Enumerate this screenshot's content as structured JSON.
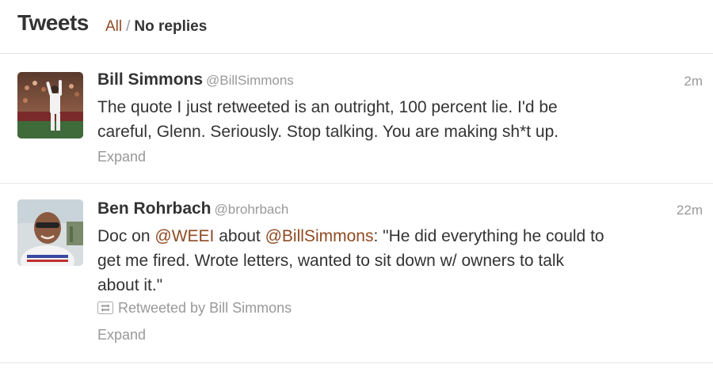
{
  "header": {
    "title": "Tweets",
    "filter_all": "All",
    "filter_separator": "/",
    "filter_no_replies": "No replies"
  },
  "colors": {
    "link": "#8f4a22",
    "muted": "#999999",
    "text": "#333333",
    "divider": "#e3e3e3"
  },
  "tweets": [
    {
      "fullname": "Bill Simmons",
      "username": "@BillSimmons",
      "time": "2m",
      "text_line1": "The quote I just retweeted is an outright, 100 percent lie. I'd be",
      "text_line2": "careful, Glenn. Seriously. Stop talking. You are making sh*t up.",
      "expand": "Expand",
      "avatar_icon": "avatar-photo-baseball-player"
    },
    {
      "fullname": "Ben Rohrbach",
      "username": "@brohrbach",
      "time": "22m",
      "text_part1": "Doc on ",
      "mention1": "@WEEI",
      "text_part2": " about ",
      "mention2": "@BillSimmons",
      "text_part3": ": \"He did everything he could to",
      "text_line2": "get me fired. Wrote letters, wanted to sit down w/ owners to talk",
      "text_line3": "about it.\"",
      "retweeted_by": "Retweeted by Bill Simmons",
      "retweet_icon": "retweet-icon",
      "expand": "Expand",
      "avatar_icon": "avatar-photo-man-sunglasses"
    }
  ]
}
